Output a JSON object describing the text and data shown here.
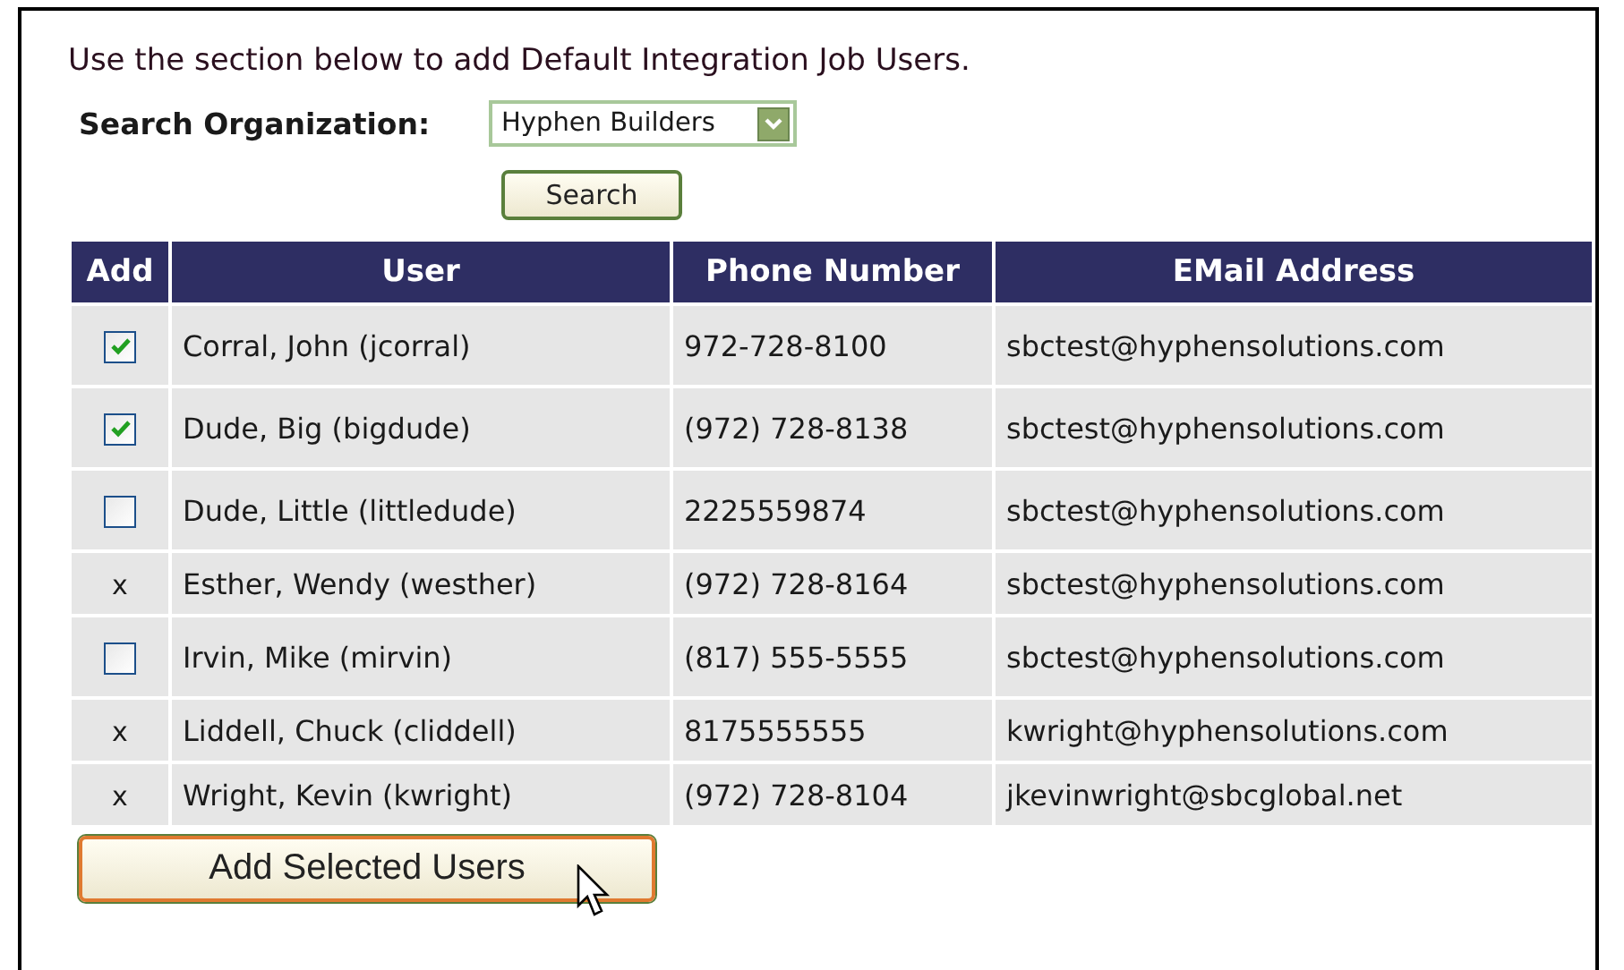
{
  "intro": "Use the section below to add Default Integration Job Users.",
  "search": {
    "label": "Search Organization:",
    "value": "Hyphen Builders",
    "button": "Search"
  },
  "table": {
    "columns": [
      "Add",
      "User",
      "Phone Number",
      "EMail Address"
    ],
    "rows": [
      {
        "kind": "checkbox",
        "checked": true,
        "user": "Corral, John (jcorral)",
        "phone": "972-728-8100",
        "email": "sbctest@hyphensolutions.com"
      },
      {
        "kind": "checkbox",
        "checked": true,
        "user": "Dude, Big (bigdude)",
        "phone": "(972) 728-8138",
        "email": "sbctest@hyphensolutions.com"
      },
      {
        "kind": "checkbox",
        "checked": false,
        "user": "Dude, Little (littledude)",
        "phone": "2225559874",
        "email": "sbctest@hyphensolutions.com"
      },
      {
        "kind": "mark",
        "mark": "x",
        "user": "Esther, Wendy (westher)",
        "phone": "(972) 728-8164",
        "email": "sbctest@hyphensolutions.com"
      },
      {
        "kind": "checkbox",
        "checked": false,
        "user": "Irvin, Mike (mirvin)",
        "phone": "(817) 555-5555",
        "email": "sbctest@hyphensolutions.com"
      },
      {
        "kind": "mark",
        "mark": "x",
        "user": "Liddell, Chuck (cliddell)",
        "phone": "8175555555",
        "email": "kwright@hyphensolutions.com"
      },
      {
        "kind": "mark",
        "mark": "x",
        "user": "Wright, Kevin (kwright)",
        "phone": "(972) 728-8104",
        "email": "jkevinwright@sbcglobal.net"
      }
    ]
  },
  "submit": "Add Selected Users"
}
